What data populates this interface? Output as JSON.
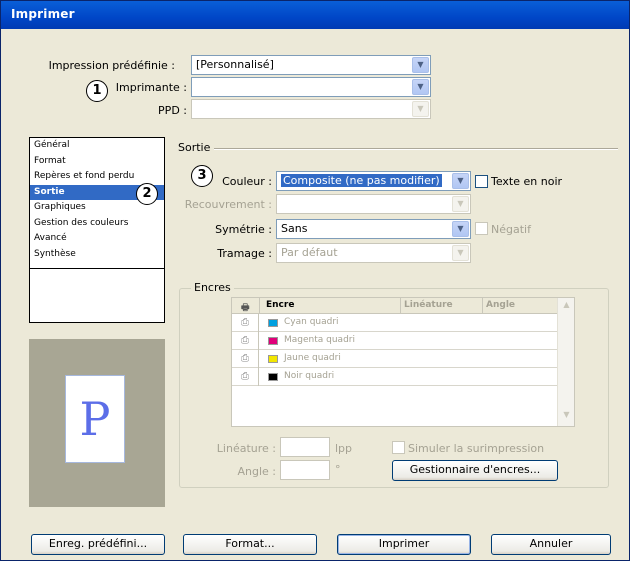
{
  "window": {
    "title": "Imprimer"
  },
  "preset": {
    "label": "Impression prédéfinie :",
    "value": "[Personnalisé]"
  },
  "printer": {
    "label": "Imprimante :",
    "value": ""
  },
  "ppd": {
    "label": "PPD :",
    "value": ""
  },
  "callouts": [
    "1",
    "2",
    "3"
  ],
  "categories": [
    "Général",
    "Format",
    "Repères et fond perdu",
    "Sortie",
    "Graphiques",
    "Gestion des couleurs",
    "Avancé",
    "Synthèse"
  ],
  "selected_category": "Sortie",
  "preview": {
    "page_letter": "P"
  },
  "output": {
    "section_title": "Sortie",
    "color": {
      "label": "Couleur :",
      "value": "Composite (ne pas modifier)"
    },
    "text_in_black": "Texte en noir",
    "trapping": {
      "label": "Recouvrement :",
      "value": ""
    },
    "symmetry": {
      "label": "Symétrie :",
      "value": "Sans"
    },
    "negative": "Négatif",
    "screening": {
      "label": "Tramage :",
      "value": "Par défaut"
    }
  },
  "inks": {
    "group_title": "Encres",
    "columns": [
      "Encre",
      "Linéature",
      "Angle"
    ],
    "rows": [
      {
        "name": "Cyan quadri",
        "color": "#00a0e0"
      },
      {
        "name": "Magenta quadri",
        "color": "#e0007a"
      },
      {
        "name": "Jaune quadri",
        "color": "#f2e600"
      },
      {
        "name": "Noir quadri",
        "color": "#000000"
      }
    ],
    "frequency": {
      "label": "Linéature :",
      "unit": "lpp"
    },
    "angle": {
      "label": "Angle :",
      "unit": "°"
    },
    "simulate_overprint": "Simuler la surimpression",
    "ink_manager_button": "Gestionnaire d'encres..."
  },
  "buttons": {
    "save_preset": "Enreg. prédéfini...",
    "setup": "Format...",
    "print": "Imprimer",
    "cancel": "Annuler"
  },
  "colors": {
    "selection": "#316ac5",
    "titlebar": "#0046c7",
    "dialog_bg": "#ece9d8"
  }
}
